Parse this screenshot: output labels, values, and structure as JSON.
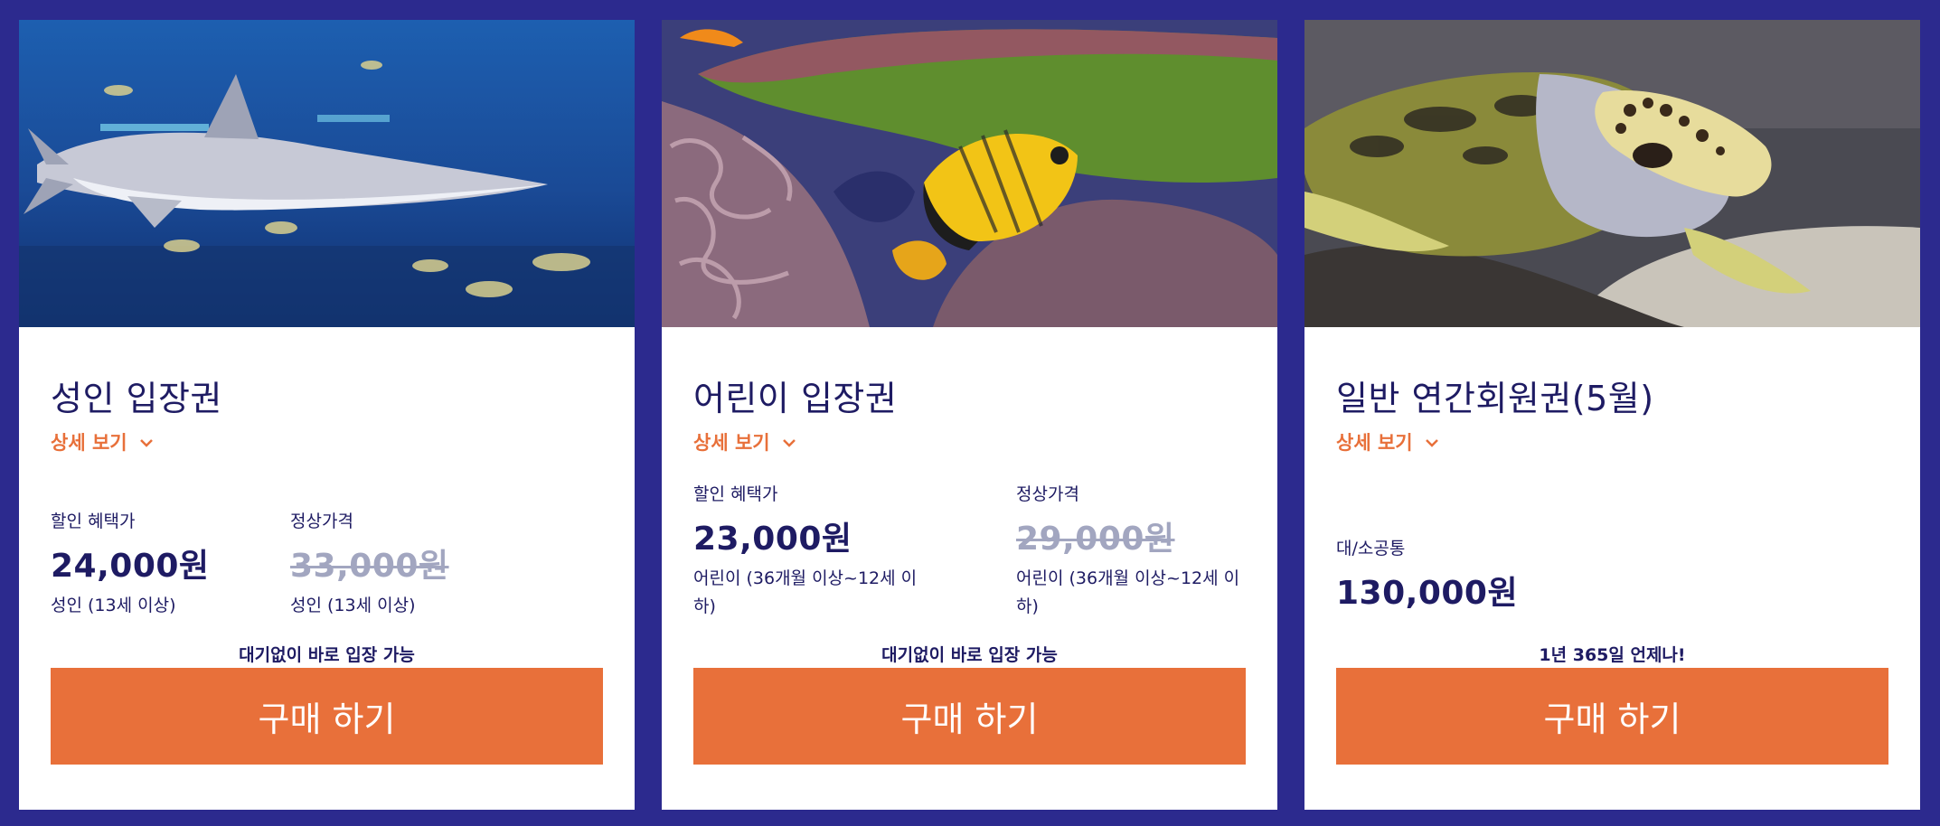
{
  "cards": [
    {
      "title": "성인 입장권",
      "details_label": "상세 보기",
      "discount_label": "할인 혜택가",
      "discount_price": "24,000원",
      "discount_note": "성인 (13세 이상)",
      "regular_label": "정상가격",
      "regular_price": "33,000원",
      "regular_note": "성인 (13세 이상)",
      "notice": "대기없이 바로 입장 가능",
      "buy_label": "구매 하기"
    },
    {
      "title": "어린이 입장권",
      "details_label": "상세 보기",
      "discount_label": "할인 혜택가",
      "discount_price": "23,000원",
      "discount_note": "어린이 (36개월 이상~12세 이하)",
      "regular_label": "정상가격",
      "regular_price": "29,000원",
      "regular_note": "어린이 (36개월 이상~12세 이하)",
      "notice": "대기없이 바로 입장 가능",
      "buy_label": "구매 하기"
    },
    {
      "title": "일반 연간회원권(5월)",
      "details_label": "상세 보기",
      "price_label": "대/소공통",
      "price": "130,000원",
      "notice": "1년 365일 언제나!",
      "buy_label": "구매 하기"
    }
  ],
  "colors": {
    "background": "#2c2a8e",
    "accent": "#e8703a",
    "text": "#1e1b63",
    "strike": "#a2a6c0"
  },
  "icons": [
    "chevron-down-icon"
  ]
}
